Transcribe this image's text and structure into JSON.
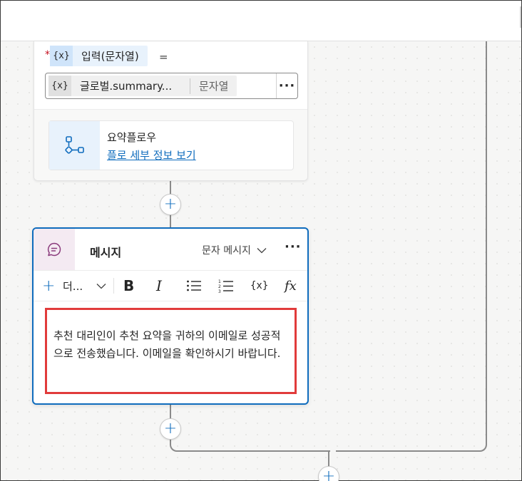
{
  "top_card": {
    "input_var_icon": "{x}",
    "input_label": "입력(문자열)",
    "equals": "=",
    "value_var_icon": "{x}",
    "value_text": "글로벌.summary...",
    "value_type": "문자열",
    "more": "···",
    "flow_icon": "flow-icon",
    "flow_name": "요약플로우",
    "flow_link": "플로 세부 정보 보기"
  },
  "message_node": {
    "icon": "chat-bubble-icon",
    "title": "메시지",
    "type_label": "문자 메시지",
    "more": "···",
    "toolbar": {
      "add": "+",
      "more_label": "더...",
      "bold": "B",
      "italic": "I",
      "variable": "{x}",
      "formula": "fx"
    },
    "body_text": "추천 대리인이 추천 요약을 귀하의 이메일로 성공적으로 전송했습니다. 이메일을 확인하시기 바랍니다."
  },
  "connectors": {
    "add_symbol": "+"
  },
  "colors": {
    "accent": "#0f6cbd",
    "highlight_border": "#e13b3b",
    "message_icon_bg": "#f4eaf2",
    "variable_chip_bg": "#cfe4fa"
  }
}
